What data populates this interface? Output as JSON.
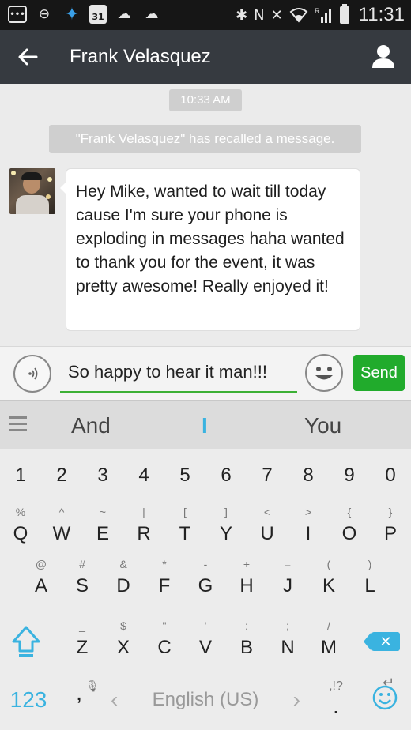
{
  "status_bar": {
    "time": "11:31",
    "calendar_day": "31",
    "signal_label": "R",
    "icons": [
      "message-icon",
      "do-not-disturb-icon",
      "app-icon",
      "calendar-icon",
      "wechat-icon",
      "wechat-icon",
      "bluetooth-icon",
      "nfc-icon",
      "mute-icon",
      "wifi-icon",
      "signal-icon",
      "battery-icon"
    ]
  },
  "app_bar": {
    "title": "Frank Velasquez"
  },
  "chat": {
    "timestamp": "10:33 AM",
    "recall_notice": "\"Frank Velasquez\" has recalled a message.",
    "messages": [
      {
        "sender": "Frank Velasquez",
        "text": "Hey Mike, wanted to wait till today cause I'm sure your phone is exploding in messages haha wanted to thank you for the event, it was pretty awesome! Really enjoyed it!"
      }
    ]
  },
  "composer": {
    "input_value": "So happy to hear it man!!!",
    "send_label": "Send"
  },
  "suggestions": [
    "And",
    "I",
    "You"
  ],
  "keyboard": {
    "numbers": [
      "1",
      "2",
      "3",
      "4",
      "5",
      "6",
      "7",
      "8",
      "9",
      "0"
    ],
    "row1": [
      {
        "k": "Q",
        "h": "%"
      },
      {
        "k": "W",
        "h": "^"
      },
      {
        "k": "E",
        "h": "~"
      },
      {
        "k": "R",
        "h": "|"
      },
      {
        "k": "T",
        "h": "["
      },
      {
        "k": "Y",
        "h": "]"
      },
      {
        "k": "U",
        "h": "<"
      },
      {
        "k": "I",
        "h": ">"
      },
      {
        "k": "O",
        "h": "{"
      },
      {
        "k": "P",
        "h": "}"
      }
    ],
    "row2": [
      {
        "k": "A",
        "h": "@"
      },
      {
        "k": "S",
        "h": "#"
      },
      {
        "k": "D",
        "h": "&"
      },
      {
        "k": "F",
        "h": "*"
      },
      {
        "k": "G",
        "h": "-"
      },
      {
        "k": "H",
        "h": "+"
      },
      {
        "k": "J",
        "h": "="
      },
      {
        "k": "K",
        "h": "("
      },
      {
        "k": "L",
        "h": ")"
      }
    ],
    "row3": [
      {
        "k": "Z",
        "h": "_"
      },
      {
        "k": "X",
        "h": "$"
      },
      {
        "k": "C",
        "h": "\""
      },
      {
        "k": "V",
        "h": "'"
      },
      {
        "k": "B",
        "h": ":"
      },
      {
        "k": "N",
        "h": ";"
      },
      {
        "k": "M",
        "h": "/"
      }
    ],
    "mode_label": "123",
    "comma": ",",
    "language_label": "English (US)",
    "period": ".",
    "period_hint": ",!?",
    "accent_color": "#3ab3e0"
  },
  "colors": {
    "app_bar": "#363a40",
    "send_button": "#21ab2c",
    "input_underline": "#3cb035"
  }
}
